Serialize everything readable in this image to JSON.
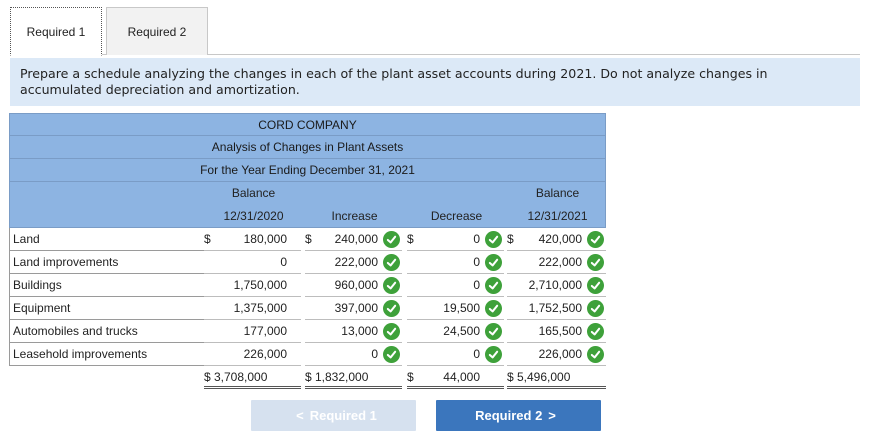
{
  "tabs": [
    {
      "label": "Required 1",
      "active": true
    },
    {
      "label": "Required 2",
      "active": false
    }
  ],
  "instructions": "Prepare a schedule analyzing the changes in each of the plant asset accounts during 2021. Do not analyze changes in accumulated depreciation and amortization.",
  "schedule": {
    "company": "CORD COMPANY",
    "title": "Analysis of Changes in Plant Assets",
    "period": "For the Year Ending December 31, 2021",
    "col_headers": {
      "c1_top": "Balance",
      "c1_bottom": "12/31/2020",
      "c2": "Increase",
      "c3": "Decrease",
      "c4_top": "Balance",
      "c4_bottom": "12/31/2021"
    },
    "currency": "$",
    "rows": [
      {
        "label": "Land",
        "begin": "180,000",
        "increase": "240,000",
        "decrease": "0",
        "end": "420,000"
      },
      {
        "label": "Land improvements",
        "begin": "0",
        "increase": "222,000",
        "decrease": "0",
        "end": "222,000"
      },
      {
        "label": "Buildings",
        "begin": "1,750,000",
        "increase": "960,000",
        "decrease": "0",
        "end": "2,710,000"
      },
      {
        "label": "Equipment",
        "begin": "1,375,000",
        "increase": "397,000",
        "decrease": "19,500",
        "end": "1,752,500"
      },
      {
        "label": "Automobiles and trucks",
        "begin": "177,000",
        "increase": "13,000",
        "decrease": "24,500",
        "end": "165,500"
      },
      {
        "label": "Leasehold improvements",
        "begin": "226,000",
        "increase": "0",
        "decrease": "0",
        "end": "226,000"
      }
    ],
    "totals": {
      "begin": "3,708,000",
      "increase": "1,832,000",
      "decrease": "44,000",
      "end": "5,496,000"
    }
  },
  "nav": {
    "prev_label": "Required 1",
    "next_label": "Required 2",
    "prev_enabled": false
  },
  "colors": {
    "correct": "#3ea13a",
    "header_bg": "#8db4e2",
    "next_btn": "#3b76bd"
  }
}
